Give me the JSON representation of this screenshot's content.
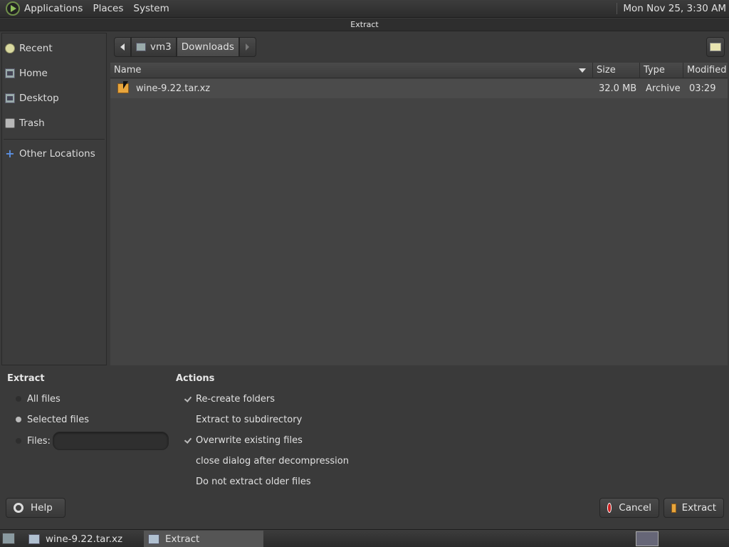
{
  "top_panel": {
    "menus": [
      "Applications",
      "Places",
      "System"
    ],
    "clock": "Mon Nov 25,  3:30 AM"
  },
  "window": {
    "title": "Extract"
  },
  "sidebar": {
    "items": [
      {
        "label": "Recent",
        "icon": "recent-icon"
      },
      {
        "label": "Home",
        "icon": "home-icon"
      },
      {
        "label": "Desktop",
        "icon": "desktop-icon"
      },
      {
        "label": "Trash",
        "icon": "trash-icon"
      },
      {
        "label": "Other Locations",
        "icon": "plus-icon"
      }
    ]
  },
  "pathbar": {
    "segments": [
      "vm3",
      "Downloads"
    ],
    "active": "Downloads"
  },
  "file_list": {
    "columns": [
      "Name",
      "Size",
      "Type",
      "Modified"
    ],
    "rows": [
      {
        "name": "wine-9.22.tar.xz",
        "size": "32.0 MB",
        "type": "Archive",
        "modified": "03:29"
      }
    ]
  },
  "extract_options": {
    "heading": "Extract",
    "all_files": "All files",
    "selected_files": "Selected files",
    "files": "Files:",
    "selected": "selected_files"
  },
  "actions": {
    "heading": "Actions",
    "recreate": "Re-create folders",
    "subdir": "Extract to subdirectory",
    "overwrite": "Overwrite existing files",
    "close_dialog": "close dialog after decompression",
    "no_older": "Do not extract older files",
    "checked": [
      "recreate",
      "overwrite"
    ]
  },
  "buttons": {
    "help": "Help",
    "cancel": "Cancel",
    "extract": "Extract"
  },
  "taskbar": {
    "tasks": [
      {
        "label": "wine-9.22.tar.xz",
        "active": false
      },
      {
        "label": "Extract",
        "active": true
      }
    ]
  }
}
